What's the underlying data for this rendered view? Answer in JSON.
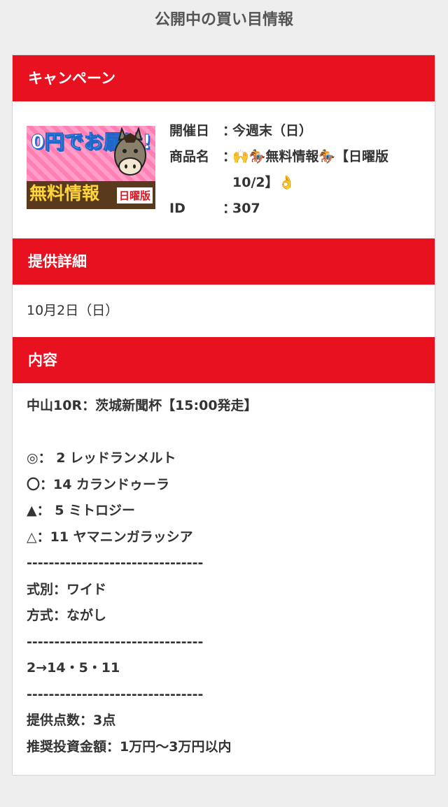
{
  "page": {
    "title": "公開中の買い目情報"
  },
  "colors": {
    "header_red": "#e8111f",
    "text": "#333333",
    "background": "#eeeeee"
  },
  "campaign": {
    "header": "キャンペーン",
    "banner": {
      "top_text": "0円でお届け!",
      "main_text": "無料情報",
      "sub_text": "日曜版",
      "icon": "horse-mascot"
    },
    "info": [
      {
        "label": "開催日",
        "colon": "：",
        "value": "今週末（日）"
      },
      {
        "label": "商品名",
        "colon": "：",
        "value": "🙌🏇無料情報🏇【日曜版10/2】👌"
      },
      {
        "label": "ID",
        "colon": "：",
        "value": "307"
      }
    ]
  },
  "provide": {
    "header": "提供詳細",
    "date": "10月2日（日）"
  },
  "content": {
    "header": "内容",
    "lines": [
      "中山10R：茨城新聞杯【15:00発走】",
      "",
      "◎： 2 レッドランメルト",
      "〇：14 カランドゥーラ",
      "▲： 5 ミトロジー",
      "△：11 ヤマニンガラッシア",
      "--------------------------------",
      "式別：ワイド",
      "方式：ながし",
      "--------------------------------",
      "2→14・5・11",
      "--------------------------------",
      "提供点数：3点",
      "推奨投資金額：1万円〜3万円以内"
    ]
  }
}
